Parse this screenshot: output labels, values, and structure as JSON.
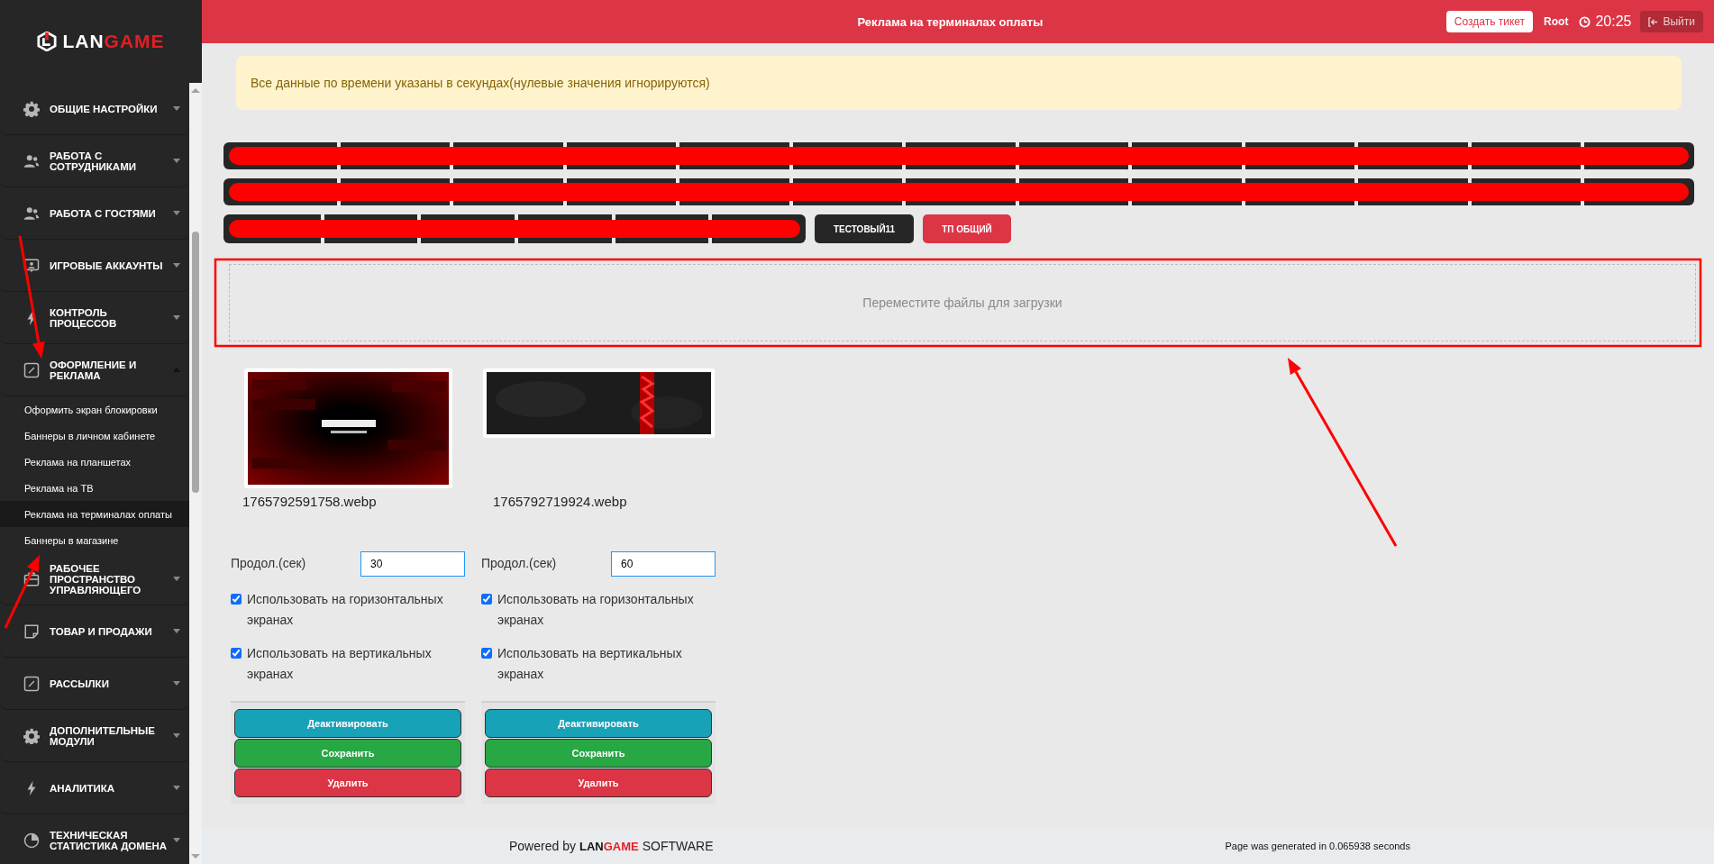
{
  "logo": {
    "text_1": "LAN",
    "text_2": "GAME"
  },
  "sidebar": {
    "items": [
      {
        "label": "ОБЩИЕ НАСТРОЙКИ",
        "expanded": false
      },
      {
        "label": "РАБОТА С СОТРУДНИКАМИ",
        "expanded": false
      },
      {
        "label": "РАБОТА С ГОСТЯМИ",
        "expanded": false
      },
      {
        "label": "ИГРОВЫЕ АККАУНТЫ",
        "expanded": false
      },
      {
        "label": "КОНТРОЛЬ ПРОЦЕССОВ",
        "expanded": false
      },
      {
        "label": "ОФОРМЛЕНИЕ И РЕКЛАМА",
        "expanded": true,
        "children": [
          {
            "label": "Оформить экран блокировки",
            "selected": false
          },
          {
            "label": "Баннеры в личном кабинете",
            "selected": false
          },
          {
            "label": "Реклама на планшетах",
            "selected": false
          },
          {
            "label": "Реклама на ТВ",
            "selected": false
          },
          {
            "label": "Реклама на терминалах оплаты",
            "selected": true
          },
          {
            "label": "Баннеры в магазине",
            "selected": false
          }
        ]
      },
      {
        "label": "РАБОЧЕЕ ПРОСТРАНСТВО УПРАВЛЯЮЩЕГО",
        "expanded": false
      },
      {
        "label": "ТОВАР И ПРОДАЖИ",
        "expanded": false
      },
      {
        "label": "РАССЫЛКИ",
        "expanded": false
      },
      {
        "label": "ДОПОЛНИТЕЛЬНЫЕ МОДУЛИ",
        "expanded": false
      },
      {
        "label": "АНАЛИТИКА",
        "expanded": false
      },
      {
        "label": "ТЕХНИЧЕСКАЯ СТАТИСТИКА ДОМЕНА",
        "expanded": false
      }
    ]
  },
  "header": {
    "title": "Реклама на терминалах оплаты",
    "ticket_button": "Создать тикет",
    "user": "Root",
    "time": "20:25",
    "logout_button": "Выйти"
  },
  "alert": "Все данные по времени указаны в секундах(нулевые значения игнорируются)",
  "tabs": [
    {
      "kind": "redacted"
    },
    {
      "kind": "redacted"
    },
    {
      "kind": "redacted"
    },
    {
      "kind": "tab",
      "label": "ТЕСТОВЫЙ11",
      "selected": false
    },
    {
      "kind": "tab",
      "label": "ТП ОБЩИЙ",
      "selected": true
    }
  ],
  "dropzone": {
    "placeholder": "Переместите файлы для загрузки"
  },
  "banners": [
    {
      "kind": "picture",
      "filename": "1765792591758.webp",
      "duration_label": "Продол.(сек)",
      "duration": "30",
      "options": [
        {
          "label": "Использовать на горизонтальных экранах",
          "checked": true
        },
        {
          "label": "Использовать на вертикальных экранах",
          "checked": true
        }
      ],
      "buttons": [
        "Деактивировать",
        "Сохранить",
        "Удалить"
      ]
    },
    {
      "kind": "picture",
      "filename": "1765792719924.webp",
      "duration_label": "Продол.(сек)",
      "duration": "60",
      "options": [
        {
          "label": "Использовать на горизонтальных экранах",
          "checked": true
        },
        {
          "label": "Использовать на вертикальных экранах",
          "checked": true
        }
      ],
      "buttons": [
        "Деактивировать",
        "Сохранить",
        "Удалить"
      ]
    }
  ],
  "footer": {
    "powered": "Powered by",
    "logo_1": "LAN",
    "logo_2": "GAME",
    "software": "SOFTWARE",
    "generated": "Page was generated in 0.065938 seconds"
  },
  "annotations": [
    {
      "kind": "arrow"
    },
    {
      "kind": "arrow"
    },
    {
      "kind": "arrow"
    },
    {
      "kind": "frame"
    }
  ]
}
